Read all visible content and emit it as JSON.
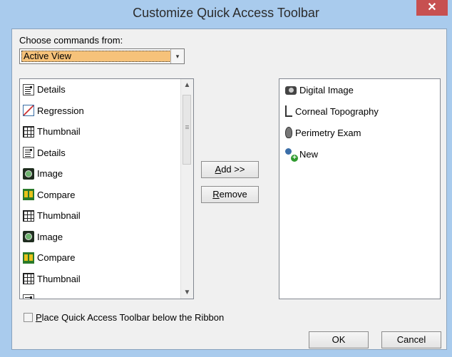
{
  "window": {
    "title": "Customize Quick Access Toolbar",
    "close_glyph": "✕"
  },
  "choose": {
    "label": "Choose commands from:",
    "selected": "Active View",
    "arrow_glyph": "▾"
  },
  "left_list": {
    "items": [
      {
        "label": "Details",
        "icon": "details-icon"
      },
      {
        "label": "Regression",
        "icon": "regression-icon"
      },
      {
        "label": "Thumbnail",
        "icon": "thumbnail-icon"
      },
      {
        "label": "Details",
        "icon": "details-icon"
      },
      {
        "label": "Image",
        "icon": "image-icon"
      },
      {
        "label": "Compare",
        "icon": "compare-icon"
      },
      {
        "label": "Thumbnail",
        "icon": "thumbnail-icon"
      },
      {
        "label": "Image",
        "icon": "image-icon"
      },
      {
        "label": "Compare",
        "icon": "compare-icon"
      },
      {
        "label": "Thumbnail",
        "icon": "thumbnail-icon"
      },
      {
        "label": "",
        "icon": "details-icon"
      }
    ],
    "scroll_up_glyph": "▲",
    "scroll_down_glyph": "▼"
  },
  "buttons": {
    "add_first": "A",
    "add_rest": "dd >>",
    "remove_first": "R",
    "remove_rest": "emove",
    "ok": "OK",
    "cancel": "Cancel"
  },
  "right_list": {
    "items": [
      {
        "label": "Digital Image",
        "icon": "camera-icon"
      },
      {
        "label": "Corneal Topography",
        "icon": "topography-icon"
      },
      {
        "label": "Perimetry Exam",
        "icon": "perimetry-icon"
      },
      {
        "label": "New",
        "icon": "new-user-icon"
      }
    ]
  },
  "checkbox": {
    "first": "P",
    "rest": "lace Quick Access Toolbar below the Ribbon",
    "checked": false
  },
  "colors": {
    "frame": "#a9cbed",
    "close": "#c75050",
    "selection": "#f6c27a"
  }
}
